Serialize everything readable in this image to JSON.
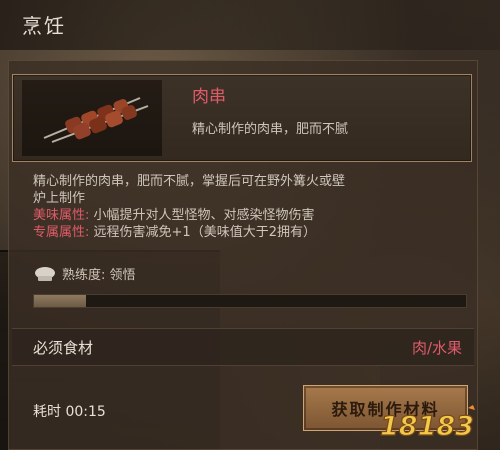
{
  "header": {
    "title": "烹饪"
  },
  "item": {
    "name": "肉串",
    "short_desc": "精心制作的肉串，肥而不腻"
  },
  "description": {
    "line1": "精心制作的肉串，肥而不腻，掌握后可在野外篝火或壁",
    "line2": "炉上制作"
  },
  "attributes": [
    {
      "label": "美味属性:",
      "value": "小幅提升对人型怪物、对感染怪物伤害"
    },
    {
      "label": "专属属性:",
      "value": "远程伤害减免+1（美味值大于2拥有）"
    }
  ],
  "proficiency": {
    "text": "熟练度: 领悟",
    "progress": 0.12
  },
  "ingredients": {
    "label": "必须食材",
    "value": "肉/水果"
  },
  "time": {
    "text": "耗时 00:15"
  },
  "action": {
    "label": "获取制作材料"
  },
  "watermark": {
    "text": "18183"
  },
  "colors": {
    "accent_red": "#e05b6a",
    "button_gold": "#a77a4c",
    "panel_border": "#a08462"
  }
}
